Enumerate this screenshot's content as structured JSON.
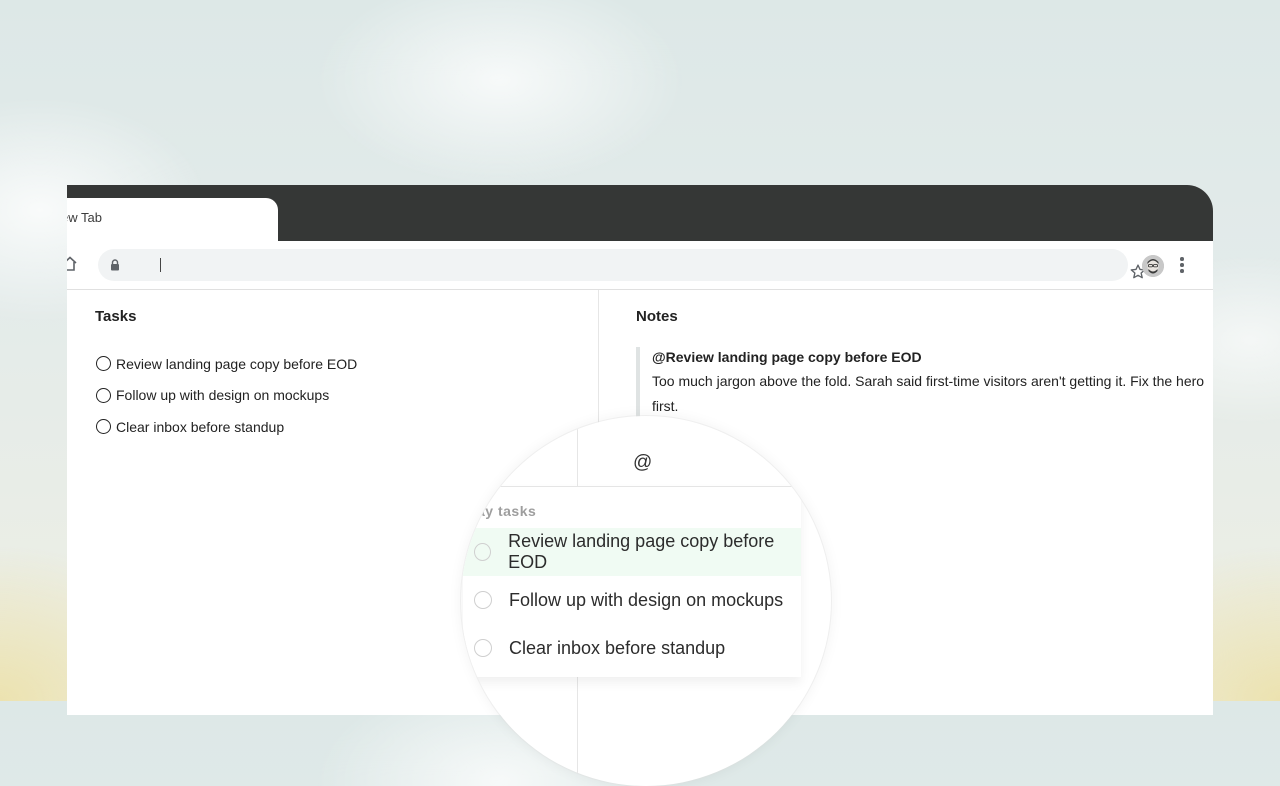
{
  "browser": {
    "tab_title": "ew Tab",
    "address_text": "",
    "icons": {
      "home": "home-icon",
      "lock": "lock-icon",
      "star": "star-icon",
      "menu": "kebab-menu-icon",
      "avatar": "avatar"
    }
  },
  "tasks": {
    "title": "Tasks",
    "items": [
      "Review landing page copy before EOD",
      "Follow up with design on mockups",
      "Clear inbox before standup"
    ]
  },
  "notes": {
    "title": "Notes",
    "note_title": "@Review landing page copy before EOD",
    "note_body": "Too much jargon above the fold. Sarah said first-time visitors aren't getting it. Fix the hero first."
  },
  "magnifier": {
    "at_symbol": "@",
    "dropdown_header": "ay tasks",
    "items": [
      "Review landing page copy before EOD",
      "Follow up with design on mockups",
      "Clear inbox before standup"
    ],
    "active_index": 0
  },
  "colors": {
    "tabbar": "#353736",
    "active_item_bg": "#f0fbf3"
  }
}
